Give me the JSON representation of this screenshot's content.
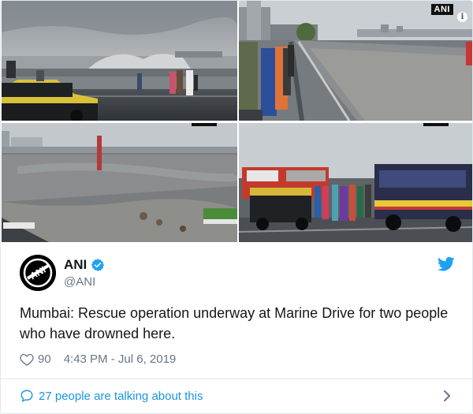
{
  "photos": {
    "watermark": "ANI",
    "items": [
      {
        "description_name": "photo-1"
      },
      {
        "description_name": "photo-2"
      },
      {
        "description_name": "photo-3"
      },
      {
        "description_name": "photo-4"
      }
    ]
  },
  "tweet": {
    "display_name": "ANI",
    "handle": "@ANI",
    "verified": true,
    "text": "Mumbai: Rescue operation underway at Marine Drive for two people who have drowned here.",
    "likes": "90",
    "timestamp": "4:43 PM - Jul 6, 2019",
    "conversation": "27 people are talking about this"
  },
  "colors": {
    "link": "#1b95e0",
    "muted": "#657786",
    "text": "#14171a",
    "border": "#e1e8ed"
  },
  "icons": {
    "verified": "verified-badge-icon",
    "brand": "twitter-bird-icon",
    "like": "heart-outline-icon",
    "reply": "speech-bubble-icon",
    "more": "chevron-right-icon",
    "info": "info-icon"
  }
}
